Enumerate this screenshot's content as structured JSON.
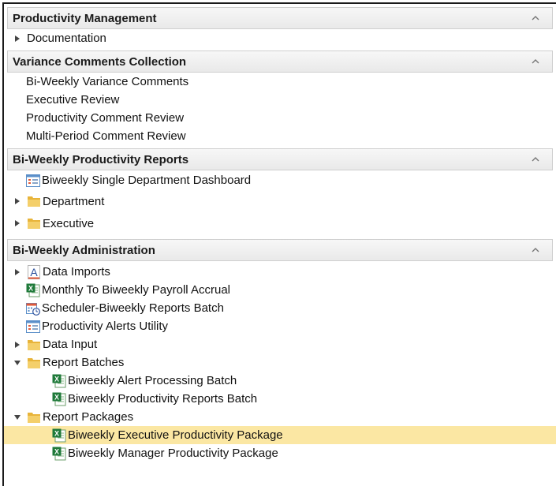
{
  "sections": [
    {
      "title": "Productivity Management",
      "items": [
        {
          "label": "Documentation",
          "kind": "expander",
          "expanded": false,
          "icon": "none"
        }
      ]
    },
    {
      "title": "Variance Comments Collection",
      "items": [
        {
          "label": "Bi-Weekly Variance Comments",
          "kind": "link"
        },
        {
          "label": "Executive Review",
          "kind": "link"
        },
        {
          "label": "Productivity Comment Review",
          "kind": "link"
        },
        {
          "label": "Multi-Period Comment Review",
          "kind": "link"
        }
      ]
    },
    {
      "title": "Bi-Weekly Productivity Reports",
      "items": [
        {
          "label": "Biweekly Single Department Dashboard",
          "icon": "dashboard-icon"
        },
        {
          "label": "Department",
          "icon": "folder-icon",
          "expanded": false
        },
        {
          "label": "Executive",
          "icon": "folder-icon",
          "expanded": false
        }
      ]
    },
    {
      "title": "Bi-Weekly Administration",
      "items": [
        {
          "label": "Data Imports",
          "icon": "import-icon",
          "expanded": false
        },
        {
          "label": "Monthly To Biweekly Payroll Accrual",
          "icon": "excel-icon"
        },
        {
          "label": "Scheduler-Biweekly Reports Batch",
          "icon": "scheduler-icon"
        },
        {
          "label": "Productivity Alerts Utility",
          "icon": "dashboard-icon"
        },
        {
          "label": "Data Input",
          "icon": "folder-icon",
          "expanded": false
        },
        {
          "label": "Report Batches",
          "icon": "folder-icon",
          "expanded": true
        },
        {
          "label": "Biweekly Alert Processing Batch",
          "icon": "excel-icon",
          "indent": 1
        },
        {
          "label": "Biweekly Productivity Reports Batch",
          "icon": "excel-icon",
          "indent": 1
        },
        {
          "label": "Report Packages",
          "icon": "folder-icon",
          "expanded": true
        },
        {
          "label": "Biweekly Executive Productivity Package",
          "icon": "excel-icon",
          "indent": 1,
          "selected": true
        },
        {
          "label": "Biweekly Manager Productivity Package",
          "icon": "excel-icon",
          "indent": 1
        }
      ]
    }
  ],
  "colors": {
    "selection": "#fbe7a3",
    "header_bg": "#ececec",
    "folder": "#e8b43a"
  }
}
